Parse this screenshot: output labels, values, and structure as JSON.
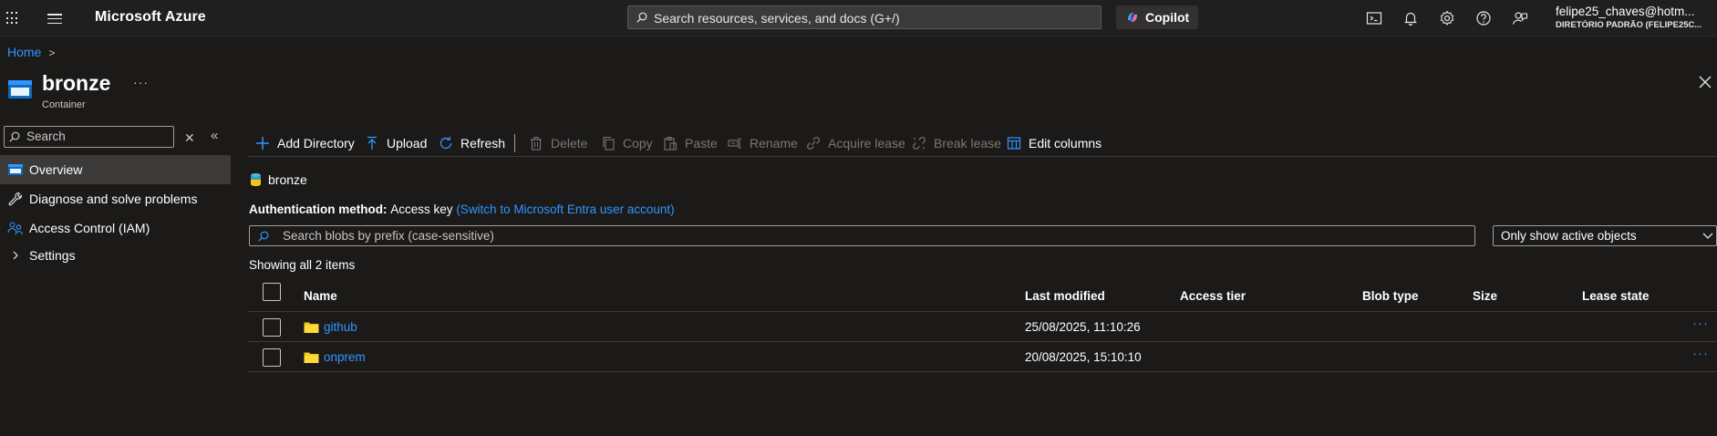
{
  "topbar": {
    "brand": "Microsoft Azure",
    "search_placeholder": "Search resources, services, and docs (G+/)",
    "copilot_label": "Copilot",
    "account_email": "felipe25_chaves@hotm...",
    "account_directory": "DIRETÓRIO PADRÃO (FELIPE25C..."
  },
  "breadcrumb": {
    "home": "Home",
    "separator": ">"
  },
  "resource": {
    "title": "bronze",
    "subtitle": "Container",
    "more": "···"
  },
  "sidebar": {
    "search_placeholder": "Search",
    "clear": "✕",
    "collapse": "«",
    "items": [
      {
        "label": "Overview",
        "icon": "container-icon",
        "active": true
      },
      {
        "label": "Diagnose and solve problems",
        "icon": "wrench-icon"
      },
      {
        "label": "Access Control (IAM)",
        "icon": "people-icon"
      },
      {
        "label": "Settings",
        "icon": "chevron-right-icon"
      }
    ]
  },
  "commands": {
    "add_directory": "Add Directory",
    "upload": "Upload",
    "refresh": "Refresh",
    "delete": "Delete",
    "copy": "Copy",
    "paste": "Paste",
    "rename": "Rename",
    "acquire_lease": "Acquire lease",
    "break_lease": "Break lease",
    "edit_columns": "Edit columns"
  },
  "path": {
    "current": "bronze"
  },
  "auth": {
    "label": "Authentication method:",
    "value": "Access key",
    "link": "(Switch to Microsoft Entra user account)"
  },
  "prefix_search": {
    "placeholder": "Search blobs by prefix (case-sensitive)"
  },
  "filter": {
    "selected": "Only show active objects"
  },
  "showing": "Showing all 2 items",
  "table": {
    "columns": {
      "name": "Name",
      "last_modified": "Last modified",
      "access_tier": "Access tier",
      "blob_type": "Blob type",
      "size": "Size",
      "lease_state": "Lease state"
    },
    "rows": [
      {
        "name": "github",
        "last_modified": "25/08/2025, 11:10:26",
        "more": "···"
      },
      {
        "name": "onprem",
        "last_modified": "20/08/2025, 15:10:10",
        "more": "···"
      }
    ]
  },
  "colors": {
    "background": "#1b1a19",
    "topbar": "#1f1f1f",
    "link": "#2f96ff",
    "disabled_text": "#797775",
    "folder": "#f2c811"
  }
}
